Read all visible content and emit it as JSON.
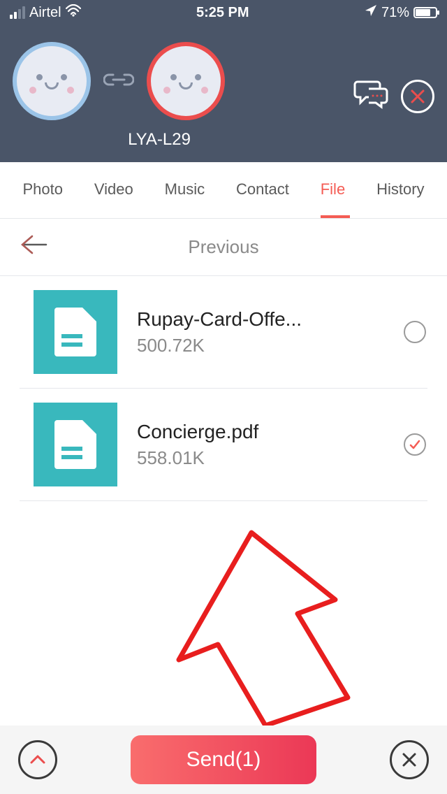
{
  "status": {
    "carrier": "Airtel",
    "time": "5:25 PM",
    "battery_pct": "71%"
  },
  "header": {
    "device_name": "LYA-L29"
  },
  "tabs": {
    "items": [
      {
        "label": "Photo"
      },
      {
        "label": "Video"
      },
      {
        "label": "Music"
      },
      {
        "label": "Contact"
      },
      {
        "label": "File"
      },
      {
        "label": "History"
      }
    ],
    "active_index": 4
  },
  "nav": {
    "previous_label": "Previous"
  },
  "files": [
    {
      "name": "Rupay-Card-Offe...",
      "size": "500.72K",
      "selected": false
    },
    {
      "name": "Concierge.pdf",
      "size": "558.01K",
      "selected": true
    }
  ],
  "bottom": {
    "send_label": "Send(1)"
  }
}
